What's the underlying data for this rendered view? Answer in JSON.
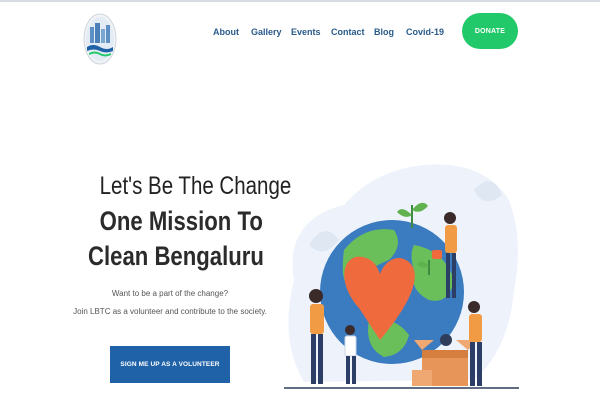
{
  "nav": {
    "items": [
      {
        "label": "About"
      },
      {
        "label": "Gallery"
      },
      {
        "label": "Events"
      },
      {
        "label": "Contact"
      },
      {
        "label": "Blog"
      },
      {
        "label": "Covid-19"
      }
    ],
    "donate_label": "DONATE"
  },
  "hero": {
    "line1": "Let's Be The Change",
    "line2": "One Mission To",
    "line3": "Clean Bengaluru",
    "sub1": "Want to be a part of the change?",
    "sub2": "Join LBTC as a volunteer and contribute to the society.",
    "cta_label": "SIGN ME UP AS A VOLUNTEER"
  },
  "colors": {
    "nav_text": "#2a5b8a",
    "donate_bg": "#22c96a",
    "cta_bg": "#1f62a8"
  }
}
